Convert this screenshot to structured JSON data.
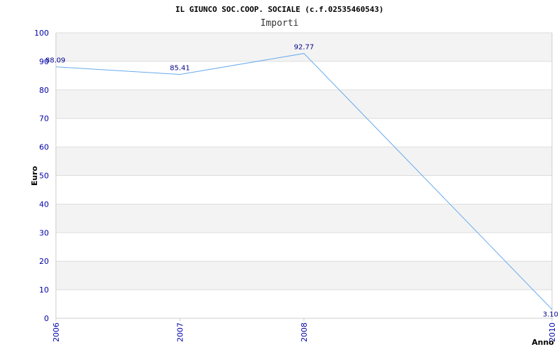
{
  "chart_data": {
    "type": "line",
    "title": "IL GIUNCO SOC.COOP. SOCIALE (c.f.02535460543)",
    "subtitle": "Importi",
    "xlabel": "Anno",
    "ylabel": "Euro",
    "x": [
      "2006",
      "2007",
      "2008",
      "2010"
    ],
    "values": [
      88.09,
      85.41,
      92.77,
      3.1
    ],
    "data_labels": [
      "88.09",
      "85.41",
      "92.77",
      "3.10"
    ],
    "ylim": [
      0,
      100
    ],
    "yticks": [
      "0",
      "10",
      "20",
      "30",
      "40",
      "50",
      "60",
      "70",
      "80",
      "90",
      "100"
    ],
    "grid": true,
    "colors": {
      "line": "#66aaee",
      "band": "#f3f3f3",
      "grid": "#dddddd",
      "tick_text": "#0000aa"
    }
  }
}
